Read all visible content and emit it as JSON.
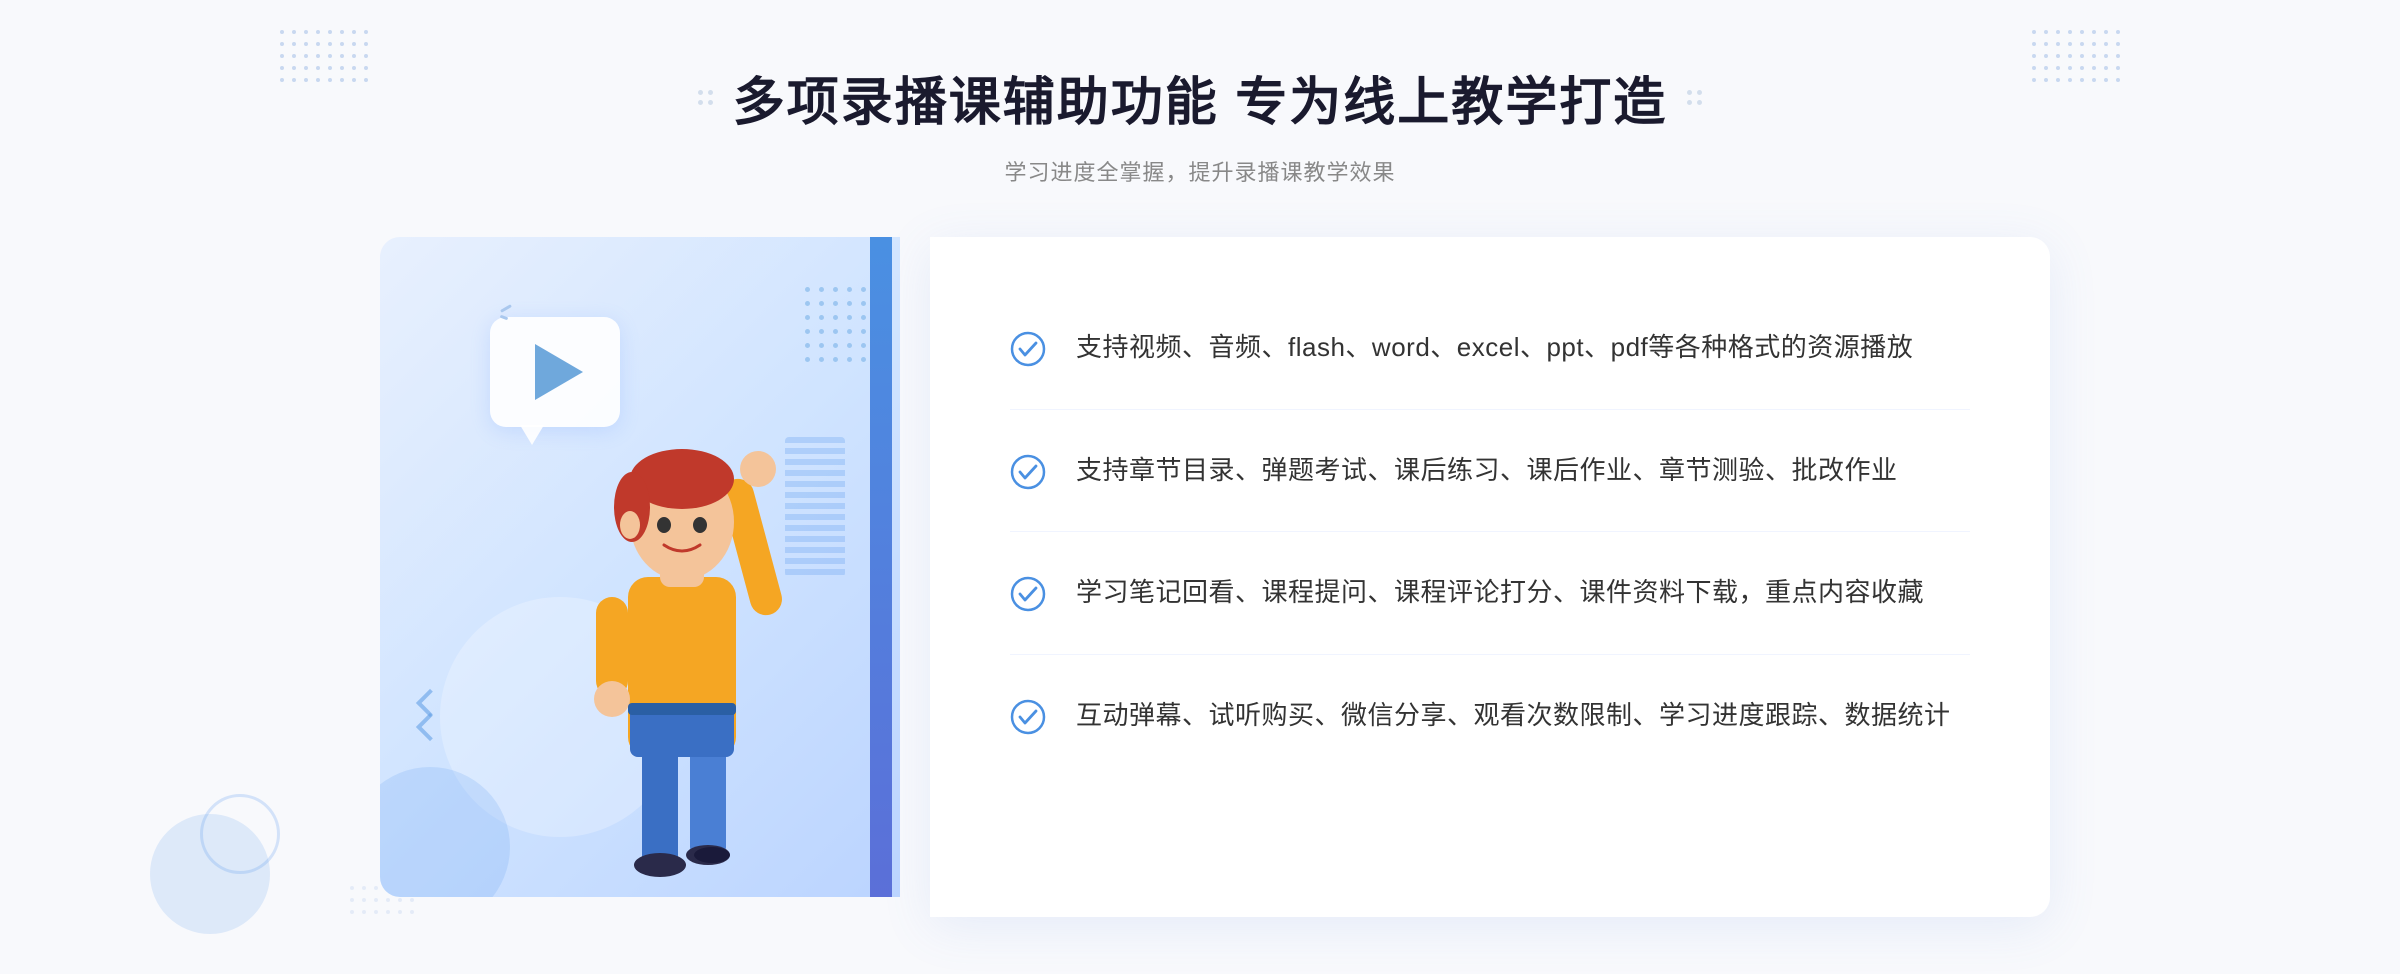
{
  "header": {
    "title": "多项录播课辅助功能 专为线上教学打造",
    "subtitle": "学习进度全掌握，提升录播课教学效果"
  },
  "features": [
    {
      "id": "feature-1",
      "text": "支持视频、音频、flash、word、excel、ppt、pdf等各种格式的资源播放"
    },
    {
      "id": "feature-2",
      "text": "支持章节目录、弹题考试、课后练习、课后作业、章节测验、批改作业"
    },
    {
      "id": "feature-3",
      "text": "学习笔记回看、课程提问、课程评论打分、课件资料下载，重点内容收藏"
    },
    {
      "id": "feature-4",
      "text": "互动弹幕、试听购买、微信分享、观看次数限制、学习进度跟踪、数据统计"
    }
  ],
  "colors": {
    "accent_blue": "#4a90e2",
    "dark_blue": "#3a6fc4",
    "light_blue_bg": "#e8f0fe",
    "text_dark": "#1a1a2e",
    "text_gray": "#888888",
    "text_body": "#333333"
  }
}
